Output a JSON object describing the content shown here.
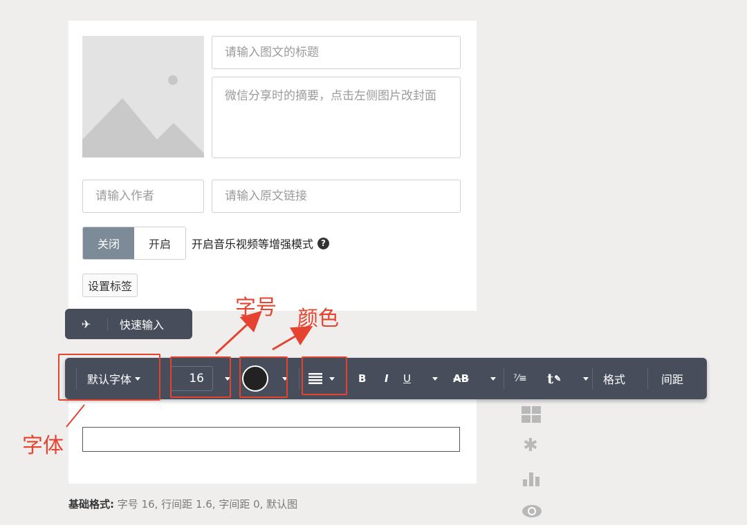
{
  "editor": {
    "title_placeholder": "请输入图文的标题",
    "summary_placeholder": "微信分享时的摘要，点击左侧图片改封面",
    "author_placeholder": "请输入作者",
    "link_placeholder": "请输入原文链接",
    "toggle_off": "关闭",
    "toggle_on": "开启",
    "enhance_label": "开启音乐视频等增强模式",
    "tag_button": "设置标签"
  },
  "quick_input": {
    "label": "快速输入"
  },
  "toolbar": {
    "font": "默认字体",
    "size": "16",
    "bold": "B",
    "italic": "I",
    "underline": "U",
    "strike": "AB",
    "format": "格式",
    "spacing": "间距",
    "icons": [
      "pin-icon",
      "align-icon",
      "fraction-icon",
      "text-color-icon"
    ]
  },
  "annotations": {
    "size": "字号",
    "color": "颜色",
    "font": "字体"
  },
  "footer": {
    "label": "基础格式:",
    "value": "字号 16, 行间距 1.6, 字间距 0, 默认图"
  },
  "colors": {
    "toolbar_bg": "#474d5b",
    "annotation_red": "#e5432f",
    "toggle_active": "#7d8b99"
  }
}
